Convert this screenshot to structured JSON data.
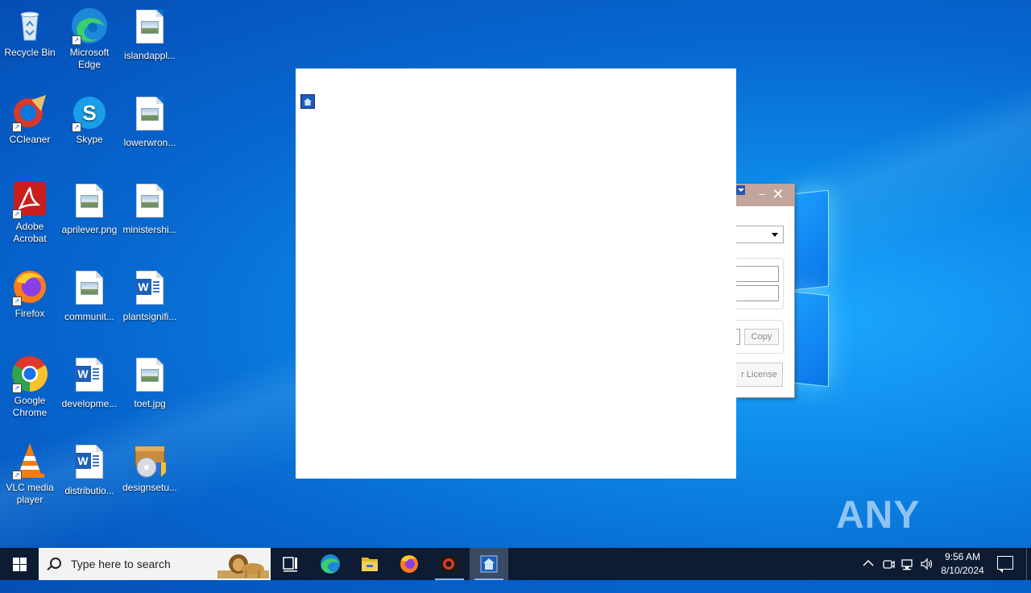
{
  "desktop": {
    "icons": [
      {
        "label": "Recycle Bin"
      },
      {
        "label": "Microsoft Edge"
      },
      {
        "label": "islandappl..."
      },
      {
        "label": "CCleaner"
      },
      {
        "label": "Skype"
      },
      {
        "label": "lowerwron..."
      },
      {
        "label": "Adobe Acrobat"
      },
      {
        "label": "aprilever.png"
      },
      {
        "label": "ministershi..."
      },
      {
        "label": "Firefox"
      },
      {
        "label": "communit..."
      },
      {
        "label": "plantsignifi..."
      },
      {
        "label": "Google Chrome"
      },
      {
        "label": "developme..."
      },
      {
        "label": "toet.jpg"
      },
      {
        "label": "VLC media player"
      },
      {
        "label": "distributio..."
      },
      {
        "label": "designsetu..."
      }
    ]
  },
  "dialog": {
    "copy_label": "Copy",
    "license_label": "r License"
  },
  "watermark": {
    "text": "ANY RUN"
  },
  "taskbar": {
    "search_placeholder": "Type here to search",
    "time": "9:56 AM",
    "date": "8/10/2024",
    "pinned": [
      "task-view-icon",
      "edge-icon",
      "file-explorer-icon",
      "firefox-icon",
      "ccleaner-icon",
      "app-icon"
    ]
  },
  "colors": {
    "desktop_blue": "#0a78dd",
    "taskbar": "#0d1c33",
    "dialog_titlebar": "#c2a59a"
  }
}
